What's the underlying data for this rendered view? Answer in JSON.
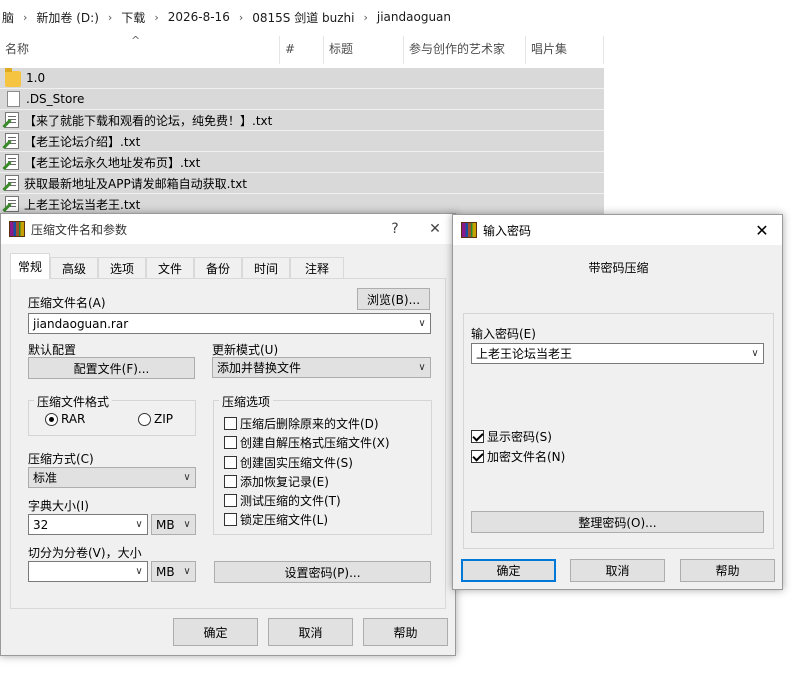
{
  "explorer": {
    "breadcrumb": [
      "脑",
      "新加卷 (D:)",
      "下载",
      "2026-8-16",
      "0815S 剑道 buzhi",
      "jiandaoguan"
    ],
    "breadcrumb_sep": "›",
    "columns": [
      "名称",
      "#",
      "标题",
      "参与创作的艺术家",
      "唱片集"
    ],
    "sort_indicator": "^",
    "files": [
      {
        "name": "1.0",
        "icon": "folder-icon"
      },
      {
        "name": ".DS_Store",
        "icon": "file-icon"
      },
      {
        "name": "【来了就能下载和观看的论坛，纯免费！】.txt",
        "icon": "text-file-icon"
      },
      {
        "name": "【老王论坛介绍】.txt",
        "icon": "text-file-icon"
      },
      {
        "name": "【老王论坛永久地址发布页】.txt",
        "icon": "text-file-icon"
      },
      {
        "name": "获取最新地址及APP请发邮箱自动获取.txt",
        "icon": "text-file-icon"
      },
      {
        "name": "上老王论坛当老王.txt",
        "icon": "text-file-icon"
      }
    ]
  },
  "archive_dialog": {
    "title": "压缩文件名和参数",
    "help_btn": "?",
    "close_btn": "✕",
    "tabs": [
      "常规",
      "高级",
      "选项",
      "文件",
      "备份",
      "时间",
      "注释"
    ],
    "archive_name_label": "压缩文件名(A)",
    "browse_btn": "浏览(B)...",
    "archive_name_value": "jiandaoguan.rar",
    "default_profile_label": "默认配置",
    "profiles_btn": "配置文件(F)...",
    "update_mode_label": "更新模式(U)",
    "update_mode_value": "添加并替换文件",
    "format_group": "压缩文件格式",
    "format_rar": "RAR",
    "format_zip": "ZIP",
    "options_group": "压缩选项",
    "options": [
      {
        "label": "压缩后删除原来的文件(D)",
        "checked": false
      },
      {
        "label": "创建自解压格式压缩文件(X)",
        "checked": false
      },
      {
        "label": "创建固实压缩文件(S)",
        "checked": false
      },
      {
        "label": "添加恢复记录(E)",
        "checked": false
      },
      {
        "label": "测试压缩的文件(T)",
        "checked": false
      },
      {
        "label": "锁定压缩文件(L)",
        "checked": false
      }
    ],
    "method_label": "压缩方式(C)",
    "method_value": "标准",
    "dict_label": "字典大小(I)",
    "dict_value": "32",
    "dict_unit": "MB",
    "split_label": "切分为分卷(V)，大小",
    "split_value": "",
    "split_unit": "MB",
    "set_password_btn": "设置密码(P)...",
    "ok_btn": "确定",
    "cancel_btn": "取消",
    "help_button": "帮助"
  },
  "password_dialog": {
    "title": "输入密码",
    "close_btn": "✕",
    "header": "带密码压缩",
    "password_label": "输入密码(E)",
    "password_value": "上老王论坛当老王",
    "show_password": {
      "label": "显示密码(S)",
      "checked": true
    },
    "encrypt_names": {
      "label": "加密文件名(N)",
      "checked": true
    },
    "organize_btn": "整理密码(O)...",
    "ok_btn": "确定",
    "cancel_btn": "取消",
    "help_btn": "帮助"
  }
}
